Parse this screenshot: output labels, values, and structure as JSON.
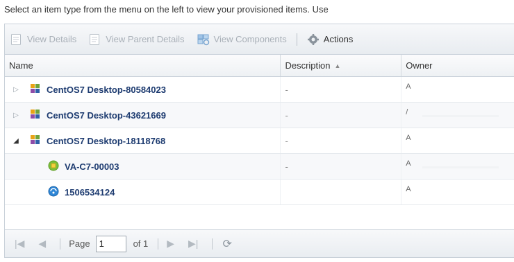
{
  "instructions": "Select an item type from the menu on the left to view your provisioned items. Use",
  "toolbar": {
    "view_details": "View Details",
    "view_parent_details": "View Parent Details",
    "view_components": "View Components",
    "actions": "Actions"
  },
  "columns": {
    "name": "Name",
    "description": "Description",
    "owner": "Owner"
  },
  "rows": [
    {
      "name": "CentOS7 Desktop-80584023",
      "description": "-",
      "owner": "A",
      "expander": "▷",
      "icon": "vm-group-icon"
    },
    {
      "name": "CentOS7 Desktop-43621669",
      "description": "-",
      "owner": "/",
      "expander": "▷",
      "icon": "vm-group-icon"
    },
    {
      "name": "CentOS7 Desktop-18118768",
      "description": "-",
      "owner": "A",
      "expander": "◢",
      "icon": "vm-group-icon"
    },
    {
      "name": "VA-C7-00003",
      "description": "-",
      "owner": "A",
      "expander": "",
      "icon": "virtual-machine-icon"
    },
    {
      "name": "1506534124",
      "description": "",
      "owner": "A",
      "expander": "",
      "icon": "network-icon"
    }
  ],
  "pager": {
    "page_label": "Page",
    "page_value": "1",
    "of_label": "of 1"
  },
  "colors": {
    "item_text": "#1d3b70",
    "border": "#c9d1d9"
  }
}
